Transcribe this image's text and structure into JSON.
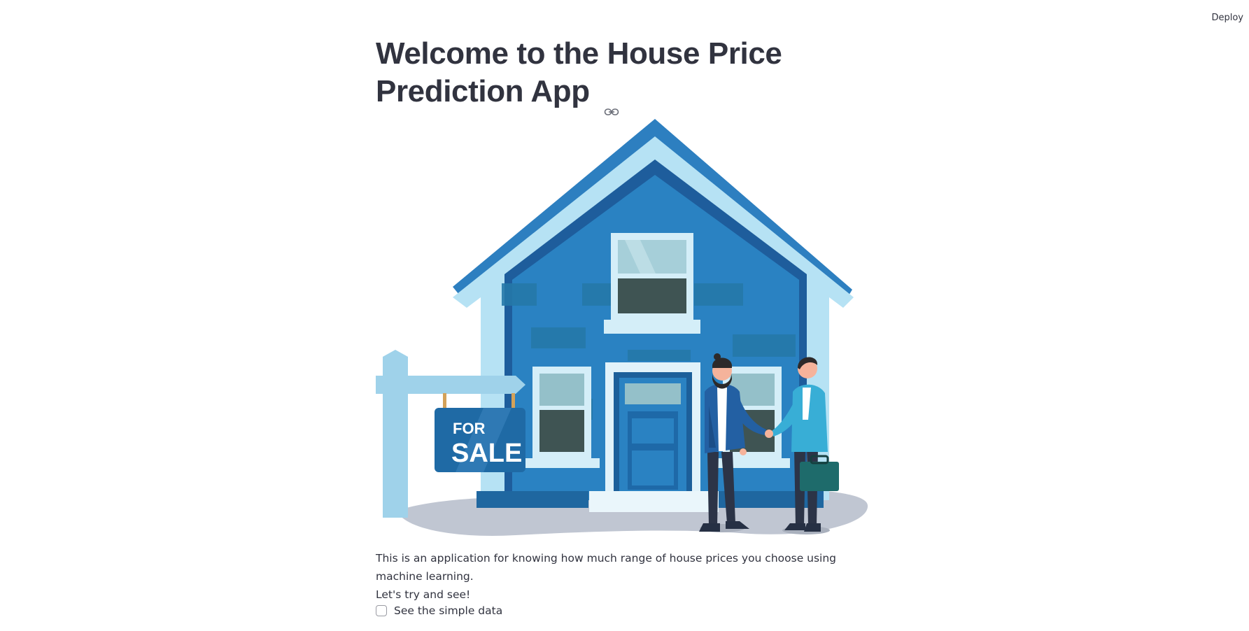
{
  "header": {
    "deploy_label": "Deploy"
  },
  "main": {
    "title_line1": "Welcome to the House Price",
    "title_line2": "Prediction App",
    "hero_sign_text_1": "FOR",
    "hero_sign_text_2": "SALE",
    "description_line1": "This is an application for knowing how much range of house prices you choose using machine learning.",
    "description_line2": "Let's try and see!",
    "checkbox": {
      "label": "See the simple data",
      "checked": false
    }
  },
  "colors": {
    "text": "#31333f",
    "house_blue": "#2a82c2",
    "roof_dark": "#2d7fc0",
    "roof_light": "#b6e2f4",
    "sign_dark": "#1f6aa5"
  }
}
